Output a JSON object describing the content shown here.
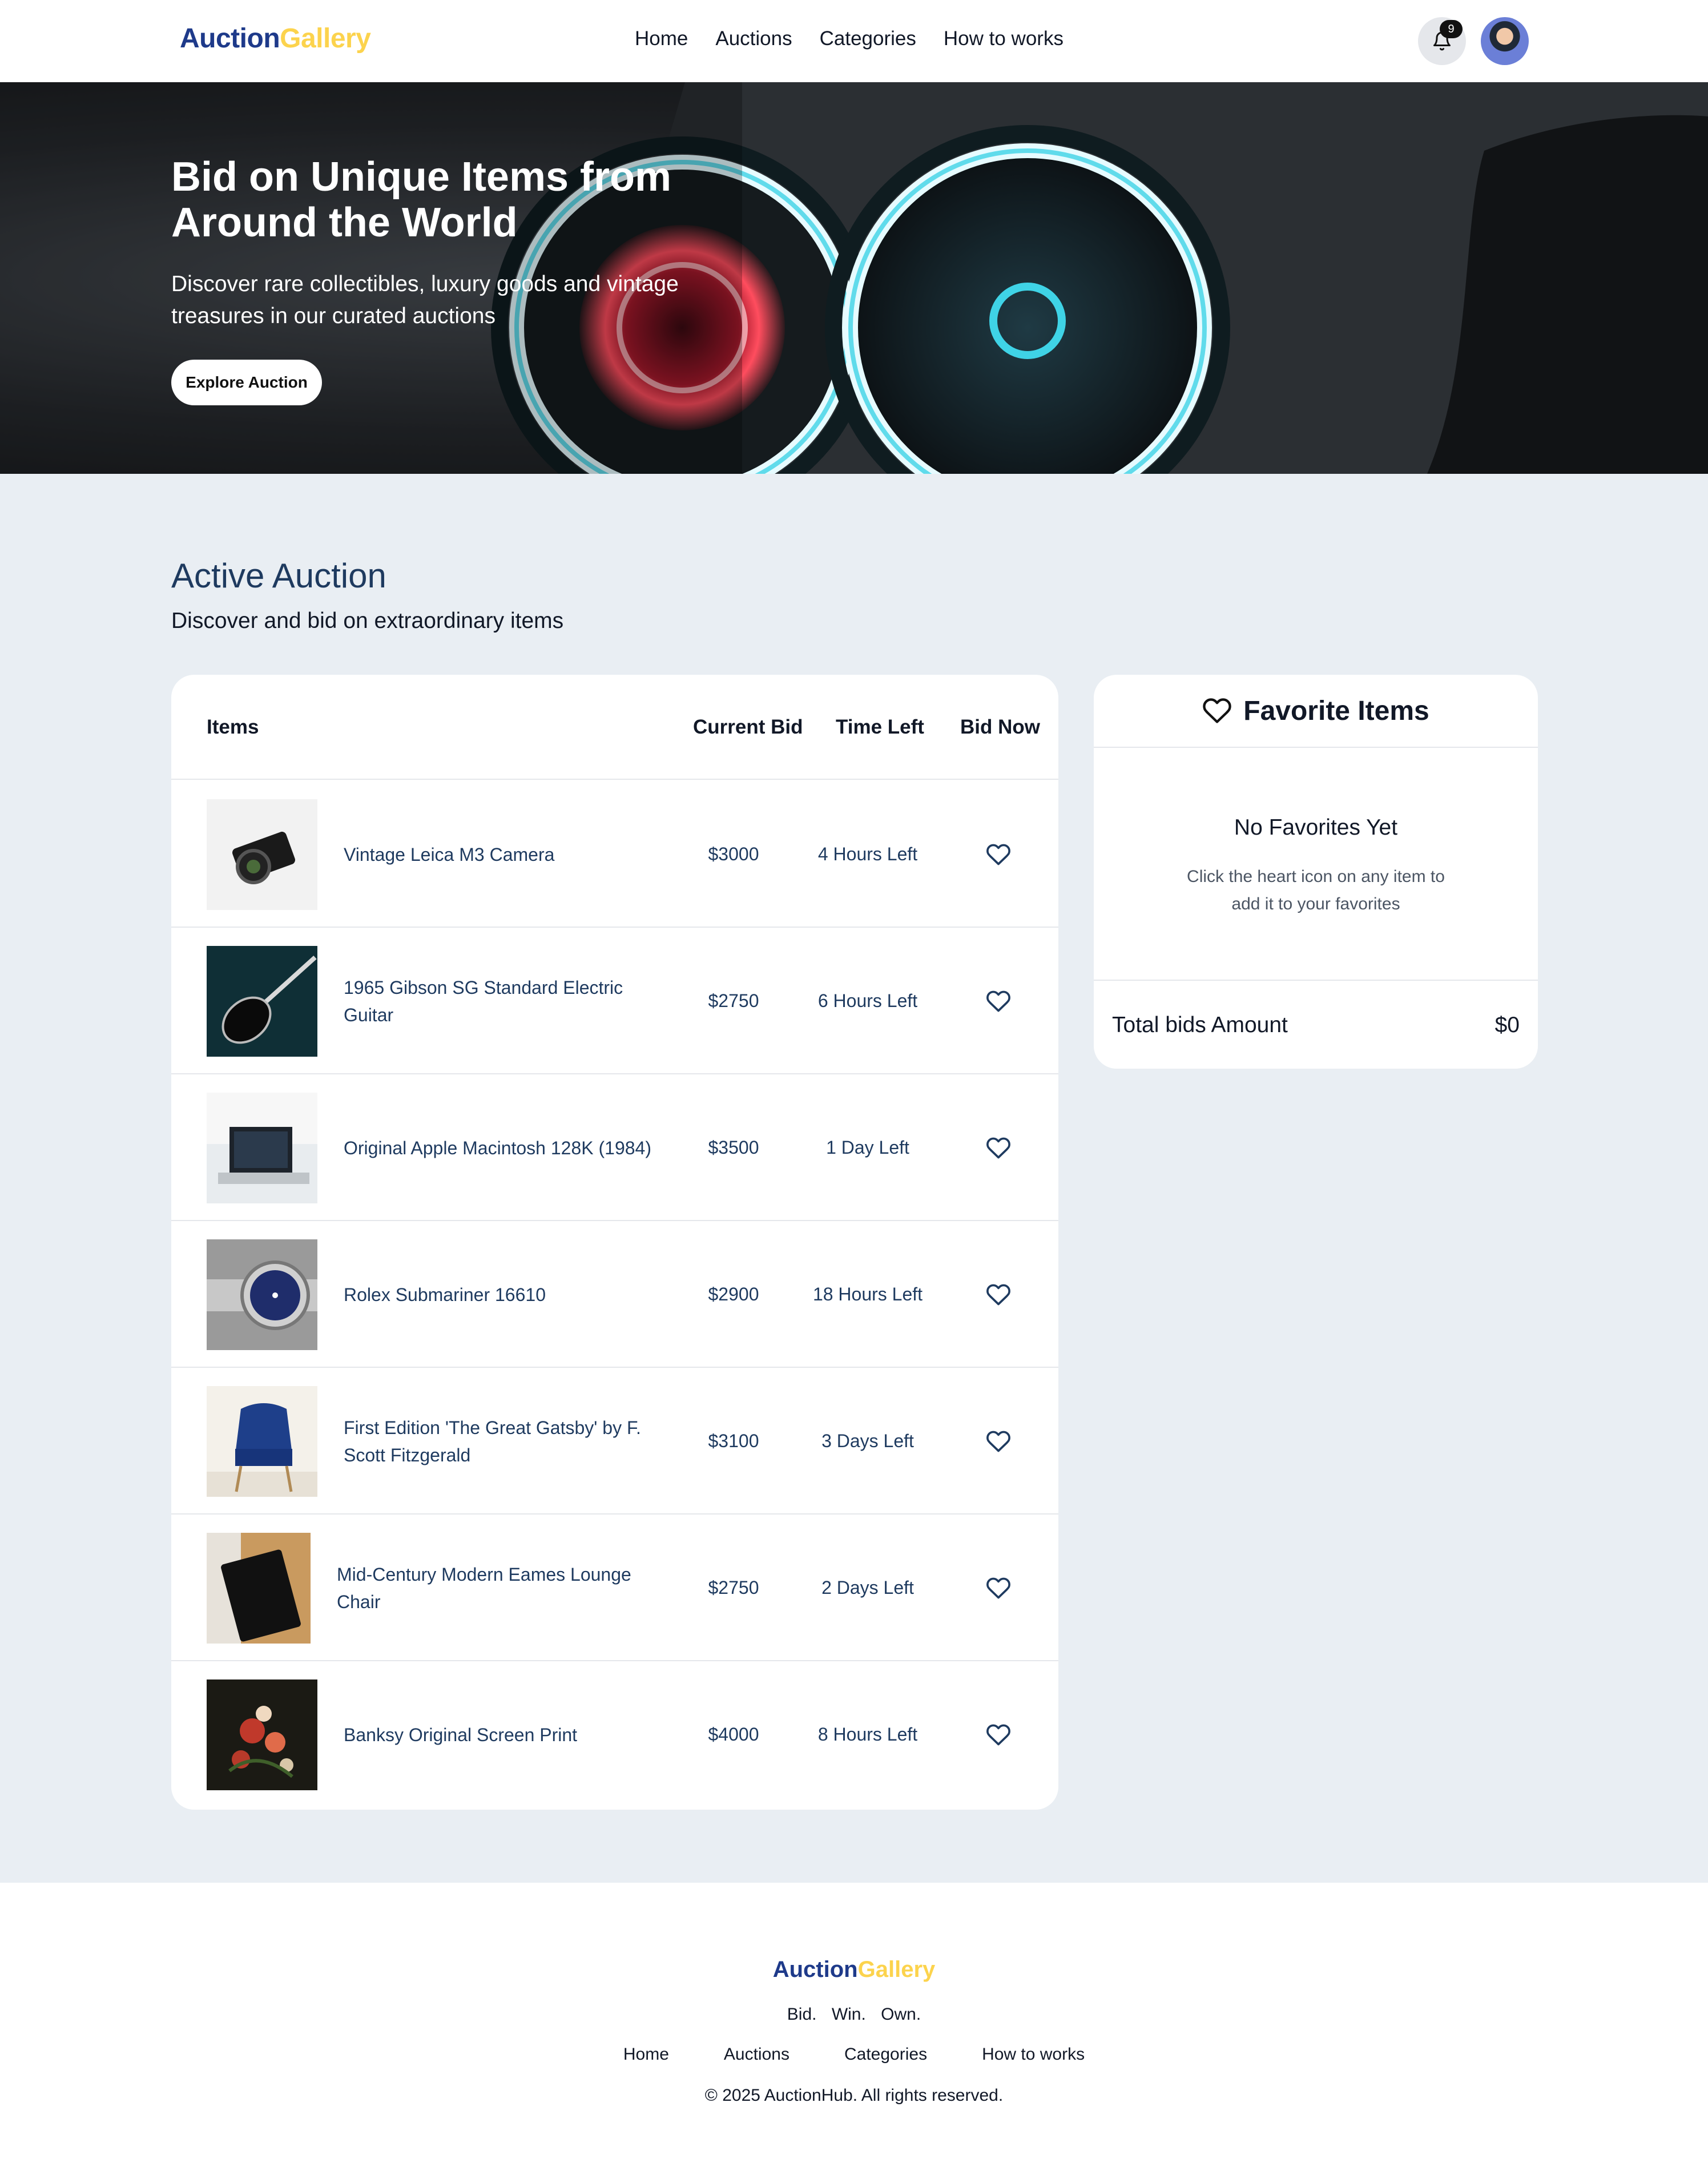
{
  "brand": {
    "part1": "Auction",
    "part2": "Gallery"
  },
  "nav": {
    "links": [
      "Home",
      "Auctions",
      "Categories",
      "How to works"
    ],
    "notification_count": "9"
  },
  "hero": {
    "title": "Bid on Unique Items from Around the World",
    "subtitle": "Discover rare collectibles, luxury goods and vintage treasures in our curated auctions",
    "button": "Explore Auction"
  },
  "section": {
    "title": "Active Auction",
    "subtitle": "Discover and bid on extraordinary items"
  },
  "table": {
    "headers": {
      "items": "Items",
      "current_bid": "Current Bid",
      "time_left": "Time Left",
      "bid_now": "Bid Now"
    },
    "rows": [
      {
        "name": "Vintage Leica M3 Camera",
        "bid": "$3000",
        "time": "4 Hours Left",
        "image": "camera"
      },
      {
        "name": "1965 Gibson SG Standard Electric Guitar",
        "bid": "$2750",
        "time": "6 Hours Left",
        "image": "guitar"
      },
      {
        "name": "Original Apple Macintosh 128K (1984)",
        "bid": "$3500",
        "time": "1 Day Left",
        "image": "laptop"
      },
      {
        "name": "Rolex Submariner 16610",
        "bid": "$2900",
        "time": "18 Hours Left",
        "image": "watch"
      },
      {
        "name": "First Edition 'The Great Gatsby' by F. Scott Fitzgerald",
        "bid": "$3100",
        "time": "3 Days Left",
        "image": "chair"
      },
      {
        "name": "Mid-Century Modern Eames Lounge Chair",
        "bid": "$2750",
        "time": "2 Days Left",
        "image": "book"
      },
      {
        "name": "Banksy Original Screen Print",
        "bid": "$4000",
        "time": "8 Hours Left",
        "image": "painting"
      }
    ]
  },
  "favorites": {
    "title": "Favorite Items",
    "empty_title": "No Favorites Yet",
    "empty_sub": "Click the heart icon on any item to add it to your favorites",
    "total_label": "Total bids Amount",
    "total_value": "$0"
  },
  "footer": {
    "tagline": "Bid. Win. Own.",
    "links": [
      "Home",
      "Auctions",
      "Categories",
      "How to works"
    ],
    "copyright": "© 2025 AuctionHub. All rights reserved."
  }
}
